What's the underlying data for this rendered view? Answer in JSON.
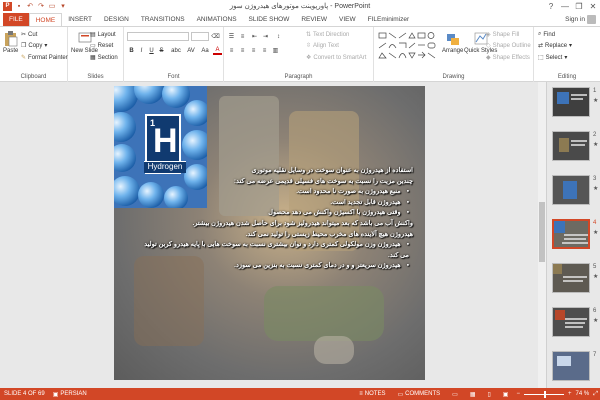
{
  "window": {
    "title": "پاورپوینت موتورهای هیدروژن سوز - PowerPoint",
    "help_label": "?",
    "minimize_label": "—",
    "restore_label": "❐",
    "close_label": "✕"
  },
  "tabs": [
    {
      "label": "FILE"
    },
    {
      "label": "HOME"
    },
    {
      "label": "INSERT"
    },
    {
      "label": "DESIGN"
    },
    {
      "label": "TRANSITIONS"
    },
    {
      "label": "ANIMATIONS"
    },
    {
      "label": "SLIDE SHOW"
    },
    {
      "label": "REVIEW"
    },
    {
      "label": "VIEW"
    },
    {
      "label": "FILEminimizer"
    }
  ],
  "active_tab": "HOME",
  "account": {
    "signin_label": "Sign in"
  },
  "ribbon": {
    "clipboard": {
      "label": "Clipboard",
      "paste": "Paste",
      "cut": "Cut",
      "copy": "Copy",
      "format_painter": "Format Painter"
    },
    "slides": {
      "label": "Slides",
      "new_slide": "New Slide",
      "layout": "Layout",
      "reset": "Reset",
      "section": "Section"
    },
    "font": {
      "label": "Font",
      "bold": "B",
      "italic": "I",
      "underline": "U",
      "strike": "S",
      "shadow": "abc",
      "spacing": "AV",
      "case": "Aa",
      "color": "A"
    },
    "paragraph": {
      "label": "Paragraph",
      "text_direction": "Text Direction",
      "align_text": "Align Text",
      "convert_smartart": "Convert to SmartArt"
    },
    "drawing": {
      "label": "Drawing",
      "arrange": "Arrange",
      "quick_styles": "Quick Styles",
      "shape_fill": "Shape Fill",
      "shape_outline": "Shape Outline",
      "shape_effects": "Shape Effects"
    },
    "editing": {
      "label": "Editing",
      "find": "Find",
      "replace": "Replace",
      "select": "Select"
    }
  },
  "slide": {
    "hydrogen": {
      "number": "1",
      "symbol": "H",
      "name": "Hydrogen"
    },
    "intro_line1": "استفاده از هیدروژن به عنوان سوخت در وسایل نقلیه موتوری",
    "intro_line2": "چندین مزیت را نسبت به سوخت های فسیلی قدیمی عرضه می کند:",
    "bullets": [
      "منبع هیدروژن به صورت نا محدود است.",
      "هیدروژن قابل تجدید است.",
      "وقتی هیدروژن با اکسیژن واکنش می دهد محصول"
    ],
    "continuation": [
      "واکنش آب می باشد که بعد میتواند هیدرولیز شود برای حاصل شدن هیدروژن بیشتر.",
      "هیدروژن هیچ آلاینده های مخرب محیط زیستی را تولید نمی کند."
    ],
    "bullets2": [
      "هیدروژن وزن مولکولی کمتری دارد و توان بیشتری نسبت به سوخت هایی با پایه هیدرو کربن تولید می کند.",
      "هیدروژن سریعتر و و در دمای کمتری نسبت به بنزین می سوزد."
    ]
  },
  "thumbnails": [
    {
      "number": "1",
      "starred": true
    },
    {
      "number": "2",
      "starred": true
    },
    {
      "number": "3",
      "starred": true
    },
    {
      "number": "4",
      "starred": true
    },
    {
      "number": "5",
      "starred": true
    },
    {
      "number": "6",
      "starred": true
    },
    {
      "number": "7",
      "starred": false
    }
  ],
  "selected_slide": "4",
  "statusbar": {
    "slide_info": "SLIDE 4 OF 69",
    "language": "PERSIAN",
    "notes": "NOTES",
    "comments": "COMMENTS",
    "zoom": "74 %",
    "zoom_out": "−",
    "zoom_in": "+",
    "star": "★"
  },
  "colors": {
    "accent": "#d24726",
    "slide_panel_blue": "#3d73b8",
    "statusbar": "#d24726"
  }
}
